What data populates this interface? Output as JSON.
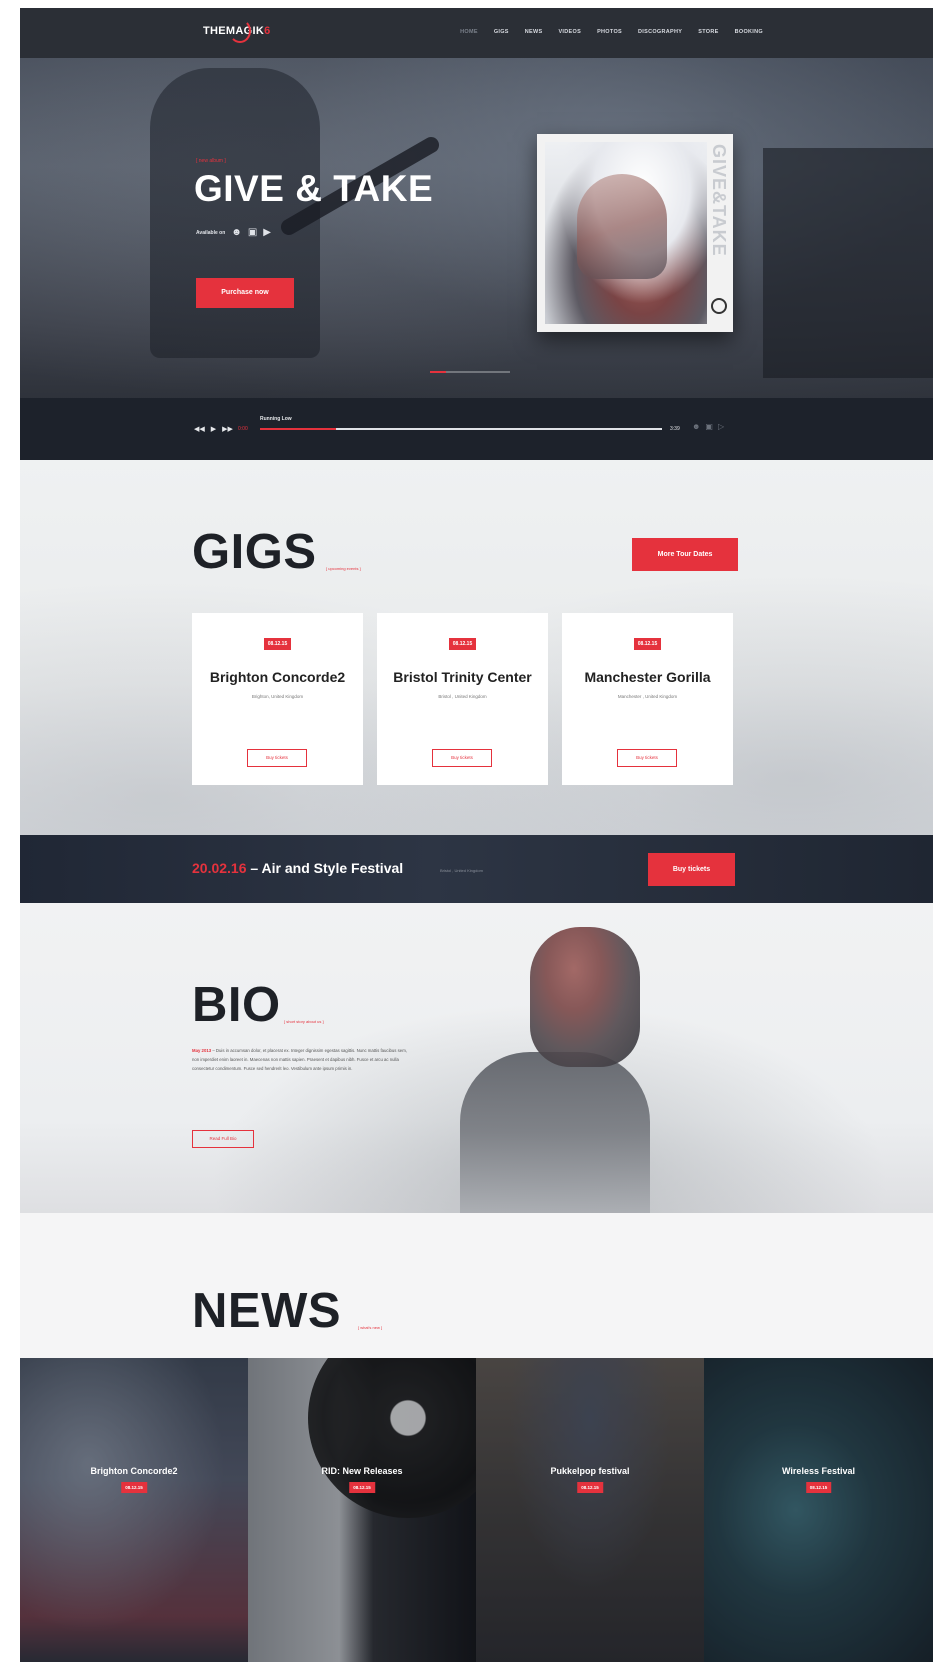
{
  "nav": {
    "logo_main": "THEMAGIK",
    "logo_accent": "6",
    "items": [
      {
        "label": "HOME"
      },
      {
        "label": "GIGS"
      },
      {
        "label": "NEWS"
      },
      {
        "label": "VIDEOS"
      },
      {
        "label": "PHOTOS"
      },
      {
        "label": "DISCOGRAPHY"
      },
      {
        "label": "STORE"
      },
      {
        "label": "BOOKING"
      }
    ]
  },
  "hero": {
    "tagline": "[ new album ]",
    "title": "GIVE & TAKE",
    "available_on": "Available on",
    "cta": "Purchase now",
    "album_cover_text": "GIVE&TAKE"
  },
  "player": {
    "track_name": "Running Low",
    "current_time": "0:00",
    "total_time": "3:39",
    "progress_percent": 19
  },
  "gigs": {
    "title": "GIGS",
    "subtitle": "[ upcoming events ]",
    "more_button": "More Tour Dates",
    "cards": [
      {
        "date": "08.12.15",
        "venue": "Brighton Concorde2",
        "location": "Brighton, United Kingdom",
        "button": "Buy tickets"
      },
      {
        "date": "08.12.15",
        "venue": "Bristol Trinity Center",
        "location": "Bristol , United Kingdom",
        "button": "Buy tickets"
      },
      {
        "date": "08.12.15",
        "venue": "Manchester Gorilla",
        "location": "Manchester , United Kingdom",
        "button": "Buy tickets"
      }
    ]
  },
  "festival": {
    "date": "20.02.16",
    "name": " – Air and Style Festival",
    "location": "Bristol , United Kingdom",
    "button": "Buy tickets"
  },
  "bio": {
    "title": "BIO",
    "subtitle": "[ short story about us ]",
    "date": "May 2013",
    "text": " – Duis in accumsan dolor, et placerat ex. Integer dignissim egestas sagittis. Nunc mattis faucibus sem, non imperdiet enim laoreet in. Maecenas non mattis sapien. Praesent et dapibus nibh. Fusce et arcu ac nulla consectetur condimentum. Fusce sed hendrerit leo. Vestibulum ante ipsum primis in.",
    "button": "Read Full Bio"
  },
  "news": {
    "title": "NEWS",
    "subtitle": "[ what's new ]",
    "items": [
      {
        "title": "Brighton Concorde2",
        "date": "08.12.15"
      },
      {
        "title": "RID: New Releases",
        "date": "08.12.15"
      },
      {
        "title": "Pukkelpop festival",
        "date": "08.12.15"
      },
      {
        "title": "Wireless Festival",
        "date": "08.12.15"
      }
    ]
  },
  "colors": {
    "accent": "#e5323d",
    "dark": "#1d222b",
    "light_bg": "#f2f3f3"
  },
  "icons": {
    "store_icons": [
      "person-icon",
      "square-icon",
      "play-store-icon"
    ],
    "player_controls": [
      "prev-icon",
      "play-icon",
      "next-icon"
    ]
  }
}
